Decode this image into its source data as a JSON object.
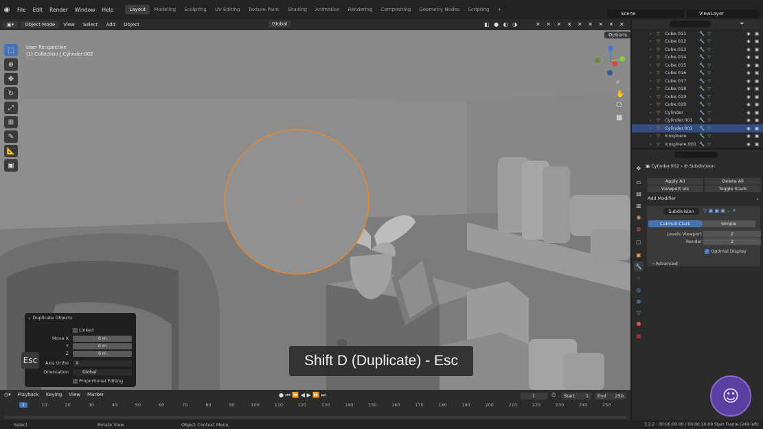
{
  "menus": [
    "File",
    "Edit",
    "Render",
    "Window",
    "Help"
  ],
  "workspaces": [
    "Layout",
    "Modeling",
    "Sculpting",
    "UV Editing",
    "Texture Paint",
    "Shading",
    "Animation",
    "Rendering",
    "Compositing",
    "Geometry Nodes",
    "Scripting"
  ],
  "scene_label": "Scene",
  "viewlayer_label": "ViewLayer",
  "header3d": {
    "mode": "Object Mode",
    "view": "View",
    "select": "Select",
    "add": "Add",
    "object": "Object",
    "orientation": "Global",
    "options": "Options"
  },
  "viewport": {
    "perspective": "User Perspective",
    "collection": "(1) Collection | Cylinder.002"
  },
  "outliner": [
    "Cube.011",
    "Cube.012",
    "Cube.013",
    "Cube.014",
    "Cube.015",
    "Cube.016",
    "Cube.017",
    "Cube.018",
    "Cube.019",
    "Cube.020",
    "Cylinder",
    "Cylinder.001",
    "Cylinder.002",
    "Icosphere",
    "Icosphere.001"
  ],
  "props": {
    "object": "Cylinder.002",
    "modifier": "Subdivision",
    "apply_all": "Apply All",
    "delete_all": "Delete All",
    "viewport_vis": "Viewport Vis",
    "toggle_stack": "Toggle Stack",
    "add_modifier": "Add Modifier",
    "mod_name": "Subdivision",
    "catmull": "Catmull-Clark",
    "simple": "Simple",
    "levels_label": "Levels Viewport",
    "levels_value": "2",
    "render_label": "Render",
    "render_value": "2",
    "optimal": "Optimal Display",
    "advanced": "Advanced"
  },
  "dup": {
    "title": "Duplicate Objects",
    "linked": "Linked",
    "move_x_label": "Move X",
    "move_x": "0 m",
    "y_label": "Y",
    "y": "0 m",
    "z_label": "Z",
    "z": "0 m",
    "axis_label": "Axis Ortho",
    "axis": "X",
    "orient_label": "Orientation",
    "orient": "Global",
    "prop_edit": "Proportional Editing"
  },
  "key_overlay": "Shift D (Duplicate) - Esc",
  "esc_label": "Esc",
  "timeline": {
    "playback": "Playback",
    "keying": "Keying",
    "view": "View",
    "marker": "Marker",
    "current": "1",
    "start_label": "Start",
    "start": "1",
    "end_label": "End",
    "end": "250",
    "ticks": [
      "1",
      "10",
      "20",
      "30",
      "40",
      "50",
      "60",
      "70",
      "80",
      "90",
      "100",
      "110",
      "120",
      "130",
      "140",
      "150",
      "160",
      "170",
      "180",
      "190",
      "200",
      "210",
      "220",
      "230",
      "240",
      "250"
    ]
  },
  "status": {
    "select": "Select",
    "rotate": "Rotate View",
    "context": "Object Context Menu",
    "version": "3.2.2 · 00:00:00:00 / 00:00:10:09 Start Frame (249 left)"
  }
}
